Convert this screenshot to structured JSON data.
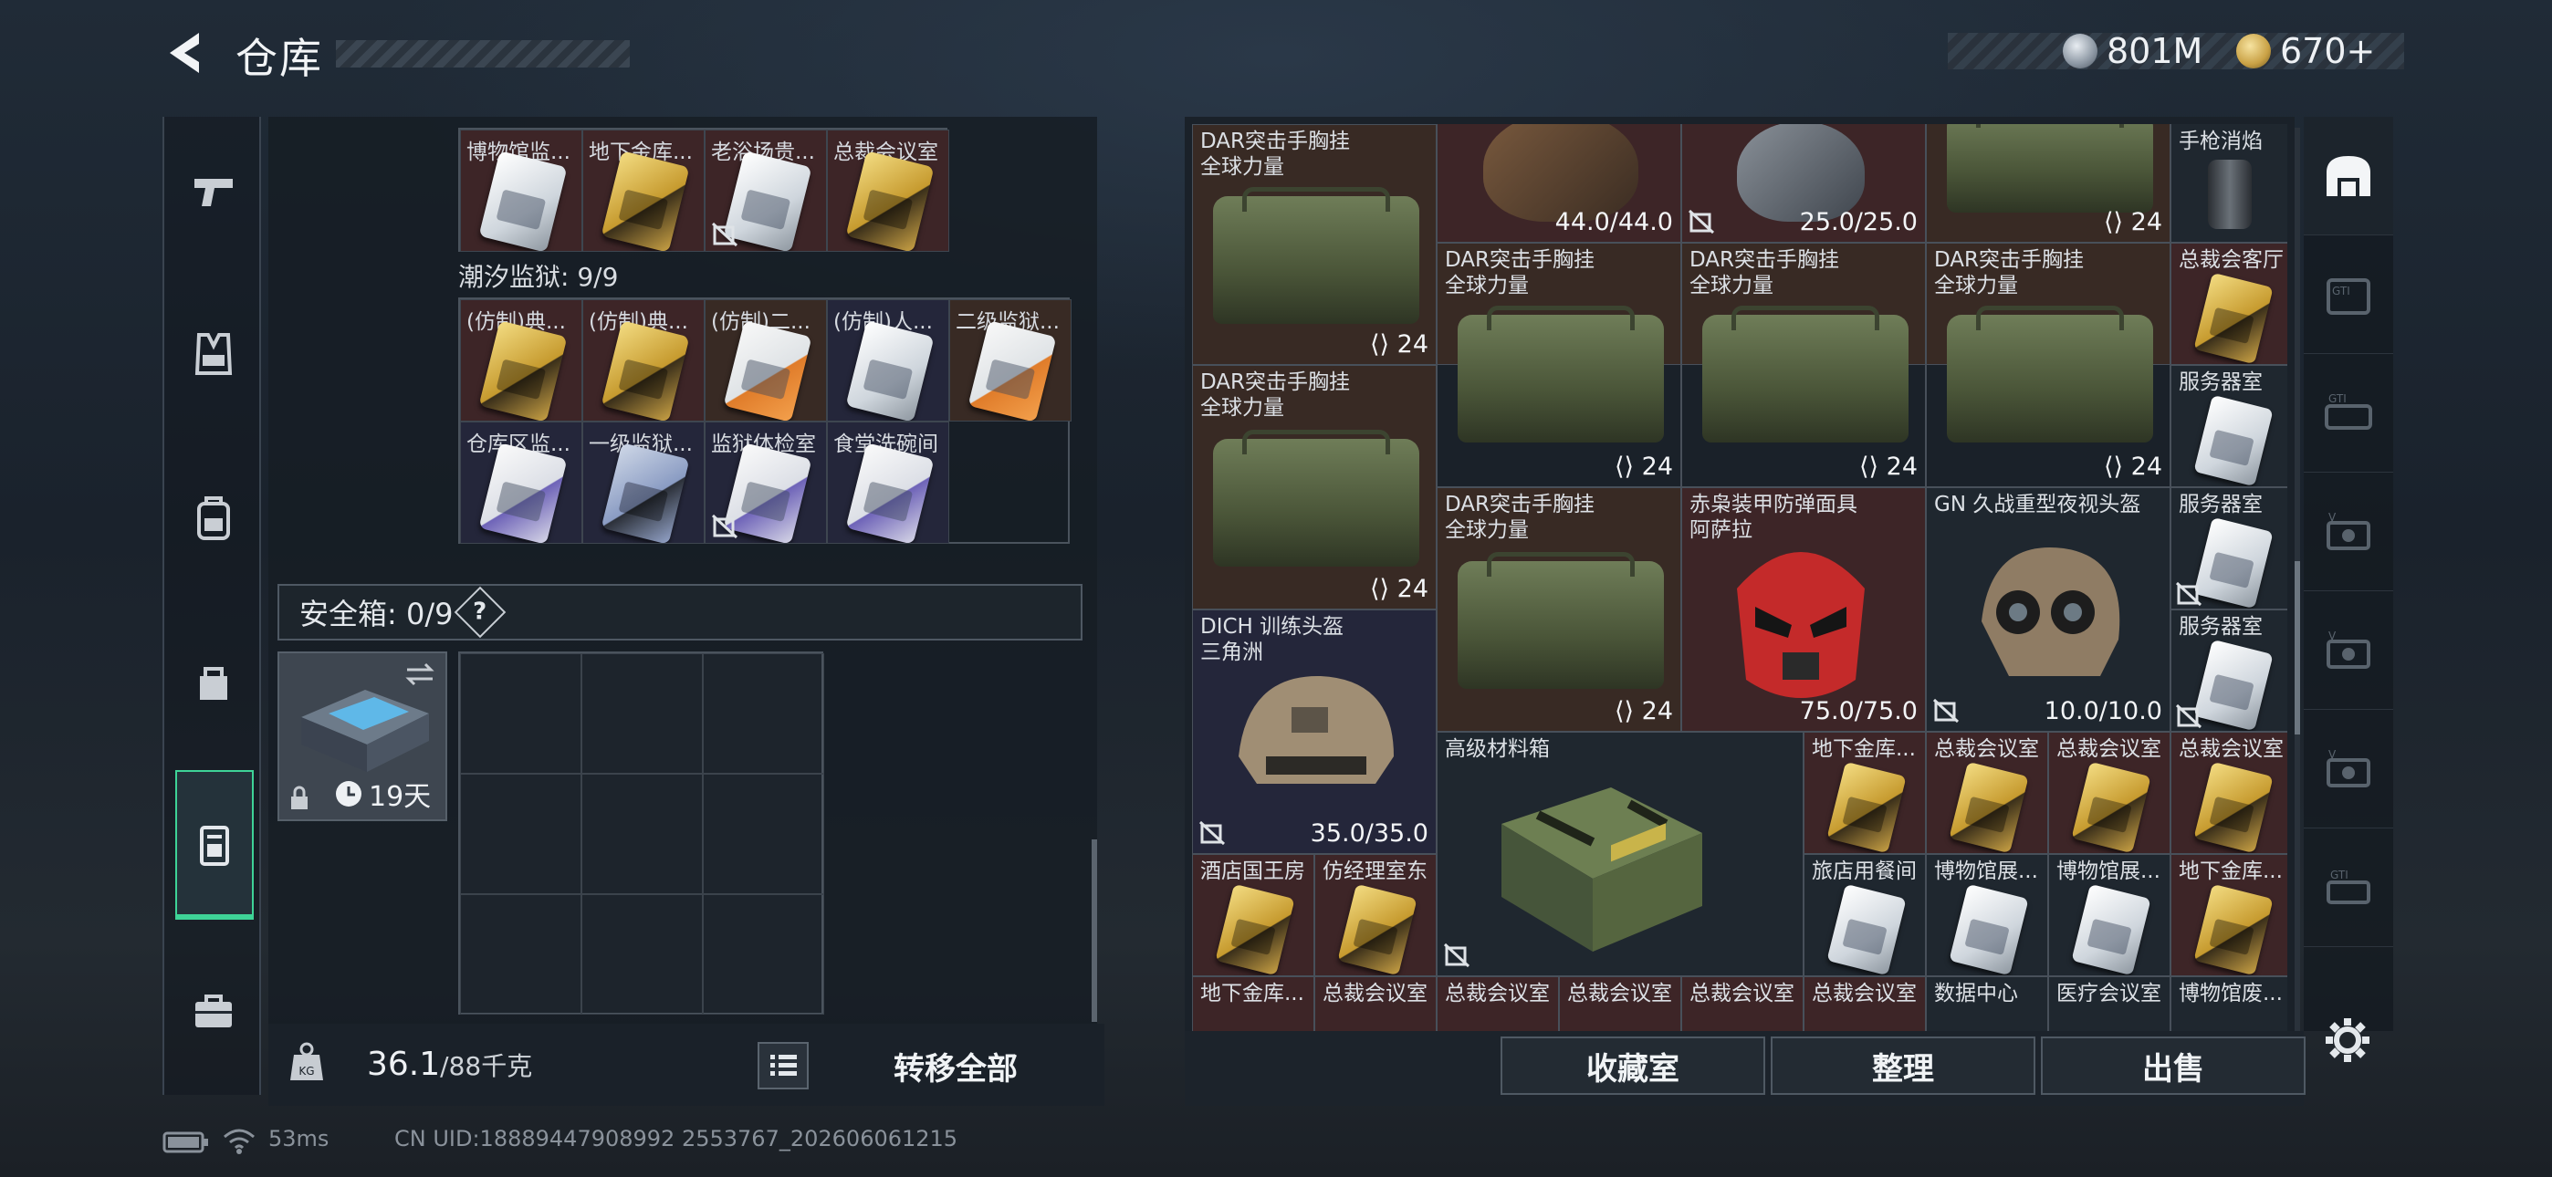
{
  "header": {
    "title": "仓库",
    "currency_a": "801M",
    "currency_b": "670+"
  },
  "left_nav": {
    "items": [
      {
        "icon": "pistol-icon"
      },
      {
        "icon": "vest-icon"
      },
      {
        "icon": "backpack-icon"
      },
      {
        "icon": "pouch-icon"
      },
      {
        "icon": "keycard-case-icon",
        "active": true
      },
      {
        "icon": "toolbox-icon"
      }
    ]
  },
  "left_panel": {
    "top_row": [
      "博物馆监...",
      "地下金库...",
      "老浴场贵...",
      "总裁会议室"
    ],
    "tidal_prison_label": "潮汐监狱: 9/9",
    "tidal_row1": [
      "(仿制)典...",
      "(仿制)典...",
      "(仿制)二...",
      "(仿制)人...",
      "二级监狱..."
    ],
    "tidal_row2": [
      "仓库区监...",
      "一级监狱...",
      "监狱体检室",
      "食堂洗碗间"
    ],
    "safe_label": "安全箱: 0/9",
    "safe_help": "?",
    "safe_timer": "19天",
    "weight_value": "36.1",
    "weight_total": "/88千克",
    "transfer_label": "转移全部"
  },
  "right_panel": {
    "labels": {
      "dar_name": "DAR突击手胸挂",
      "dar_sub": "全球力量",
      "pistol_suppressor": "手枪消焰",
      "exec_lounge": "总裁会客厅",
      "server_room": "服务器室",
      "red_mask": "赤枭装甲防弹面具",
      "red_mask_sub": "阿萨拉",
      "nv_helmet": "GN 久战重型夜视头盔",
      "dich_helmet": "DICH 训练头盔",
      "dich_sub": "三角洲",
      "material_box": "高级材料箱",
      "vault": "地下金库...",
      "exec_meeting": "总裁会议室",
      "hotel_king": "酒店国王房",
      "manager_room": "仿经理室东",
      "hotel_dining": "旅店用餐间",
      "museum_exhibit": "博物馆展...",
      "museum_abandoned": "博物馆废...",
      "data_center": "数据中心",
      "medical_meeting": "医疗会议室"
    },
    "values": {
      "top_helmet": "44.0/44.0",
      "top_mask": "25.0/25.0",
      "stack_24": "24",
      "red_mask": "75.0/75.0",
      "nv_helmet": "10.0/10.0",
      "dich_helmet": "35.0/35.0"
    },
    "buttons": {
      "collection": "收藏室",
      "organize": "整理",
      "sell": "出售"
    }
  },
  "status_bar": {
    "latency": "53ms",
    "uid": "CN UID:18889447908992 2553767_202606061215"
  },
  "colors": {
    "accent_green": "#3ed397",
    "cell_red": "#3d2527",
    "cell_navy": "#24263a"
  }
}
